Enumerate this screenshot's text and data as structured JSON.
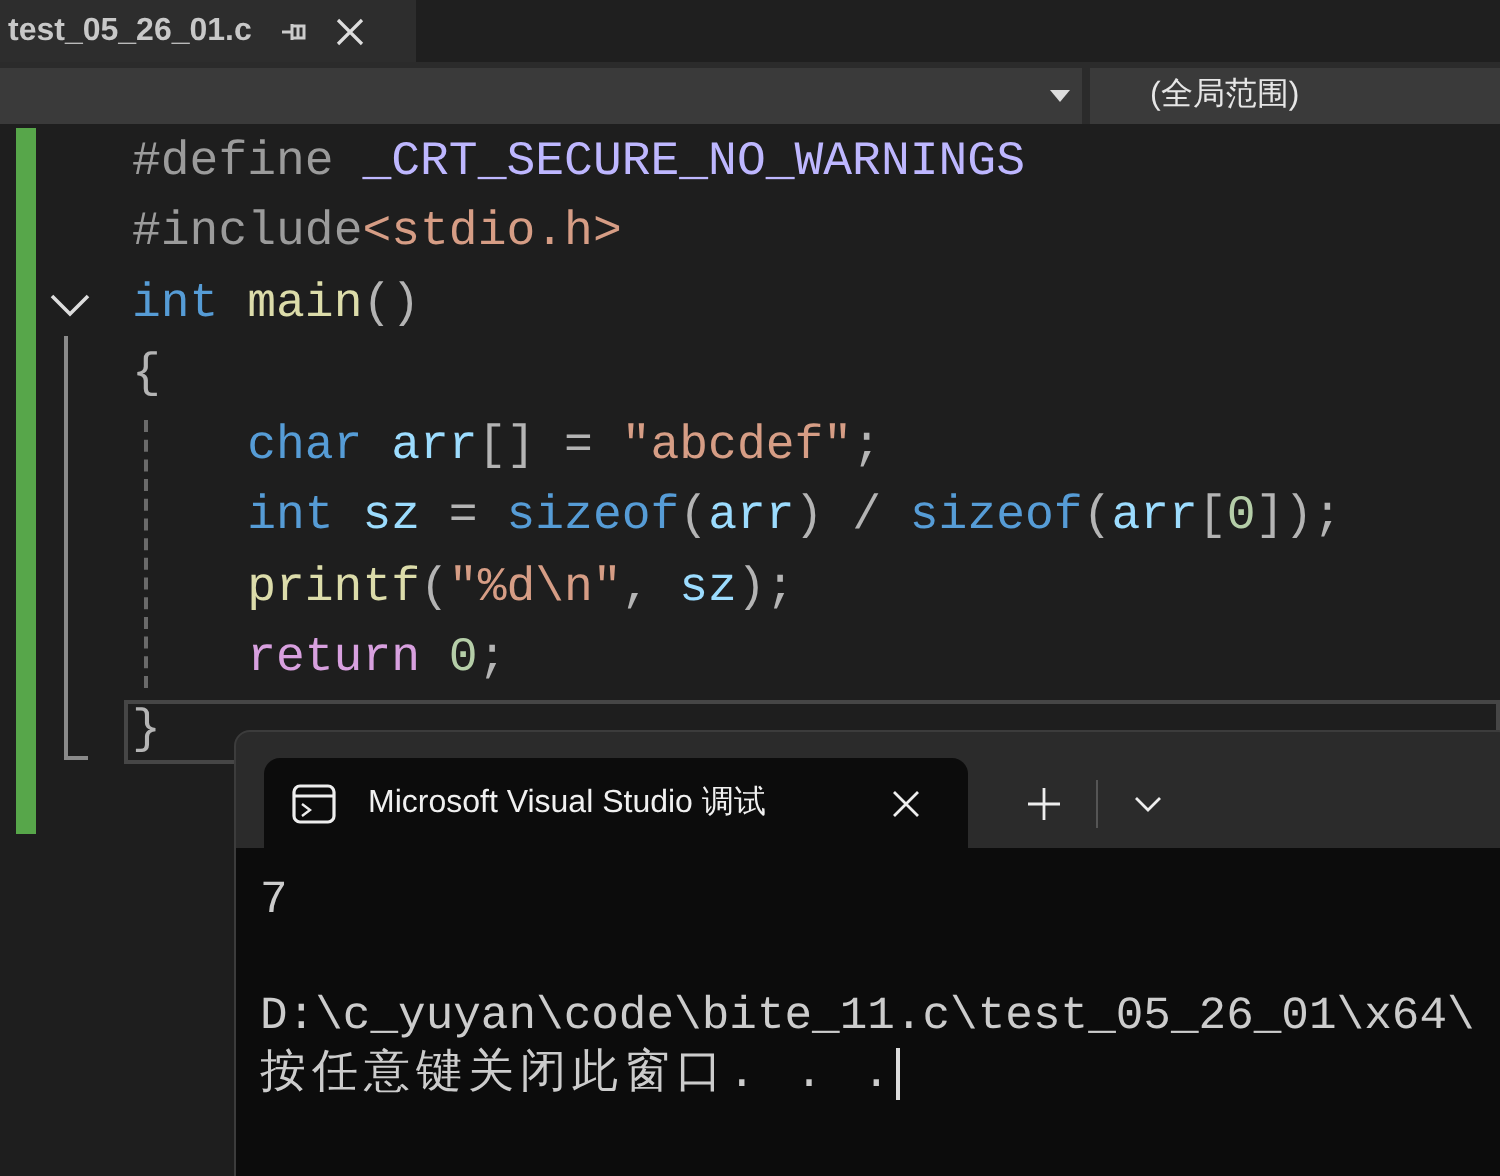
{
  "tab": {
    "title": "test_05_26_01.c",
    "pinned": false
  },
  "navigation_bar": {
    "scope": "(全局范围)"
  },
  "code_lines": [
    {
      "tokens": [
        {
          "kind": "preproc",
          "text": "#define "
        },
        {
          "kind": "macro",
          "text": "_CRT_SECURE_NO_WARNINGS"
        }
      ]
    },
    {
      "tokens": [
        {
          "kind": "preproc",
          "text": "#include"
        },
        {
          "kind": "string",
          "text": "<stdio.h>"
        }
      ]
    },
    {
      "tokens": [
        {
          "kind": "keyword",
          "text": "int "
        },
        {
          "kind": "function",
          "text": "main"
        },
        {
          "kind": "plain",
          "text": "()"
        }
      ],
      "expanded": true
    },
    {
      "tokens": [
        {
          "kind": "plain",
          "text": "{"
        }
      ],
      "children": [
        {
          "tokens": [
            {
              "kind": "keyword",
              "text": "char "
            },
            {
              "kind": "variable",
              "text": "arr"
            },
            {
              "kind": "plain",
              "text": "[] = "
            },
            {
              "kind": "string",
              "text": "\"abcdef\""
            },
            {
              "kind": "plain",
              "text": ";"
            }
          ]
        },
        {
          "tokens": [
            {
              "kind": "keyword",
              "text": "int "
            },
            {
              "kind": "variable",
              "text": "sz"
            },
            {
              "kind": "plain",
              "text": " = "
            },
            {
              "kind": "keyword",
              "text": "sizeof"
            },
            {
              "kind": "plain",
              "text": "("
            },
            {
              "kind": "variable",
              "text": "arr"
            },
            {
              "kind": "plain",
              "text": ") / "
            },
            {
              "kind": "keyword",
              "text": "sizeof"
            },
            {
              "kind": "plain",
              "text": "("
            },
            {
              "kind": "variable",
              "text": "arr"
            },
            {
              "kind": "plain",
              "text": "["
            },
            {
              "kind": "number",
              "text": "0"
            },
            {
              "kind": "plain",
              "text": "]);"
            }
          ]
        },
        {
          "tokens": [
            {
              "kind": "function",
              "text": "printf"
            },
            {
              "kind": "plain",
              "text": "("
            },
            {
              "kind": "string",
              "text": "\"%d\\n\""
            },
            {
              "kind": "plain",
              "text": ", "
            },
            {
              "kind": "variable",
              "text": "sz"
            },
            {
              "kind": "plain",
              "text": ");"
            }
          ]
        },
        {
          "tokens": [
            {
              "kind": "control",
              "text": "return "
            },
            {
              "kind": "number",
              "text": "0"
            },
            {
              "kind": "plain",
              "text": ";"
            }
          ]
        }
      ]
    },
    {
      "tokens": [
        {
          "kind": "plain",
          "text": "}"
        }
      ],
      "current": true
    }
  ],
  "console": {
    "tab_title": "Microsoft Visual Studio 调试",
    "output_blocks": [
      {
        "lines": [
          "7"
        ]
      },
      {
        "lines": [
          "D:\\c_yuyan\\code\\bite_11.c\\test_05_26_01\\x64\\",
          "按任意键关闭此窗口. . ."
        ]
      }
    ]
  }
}
